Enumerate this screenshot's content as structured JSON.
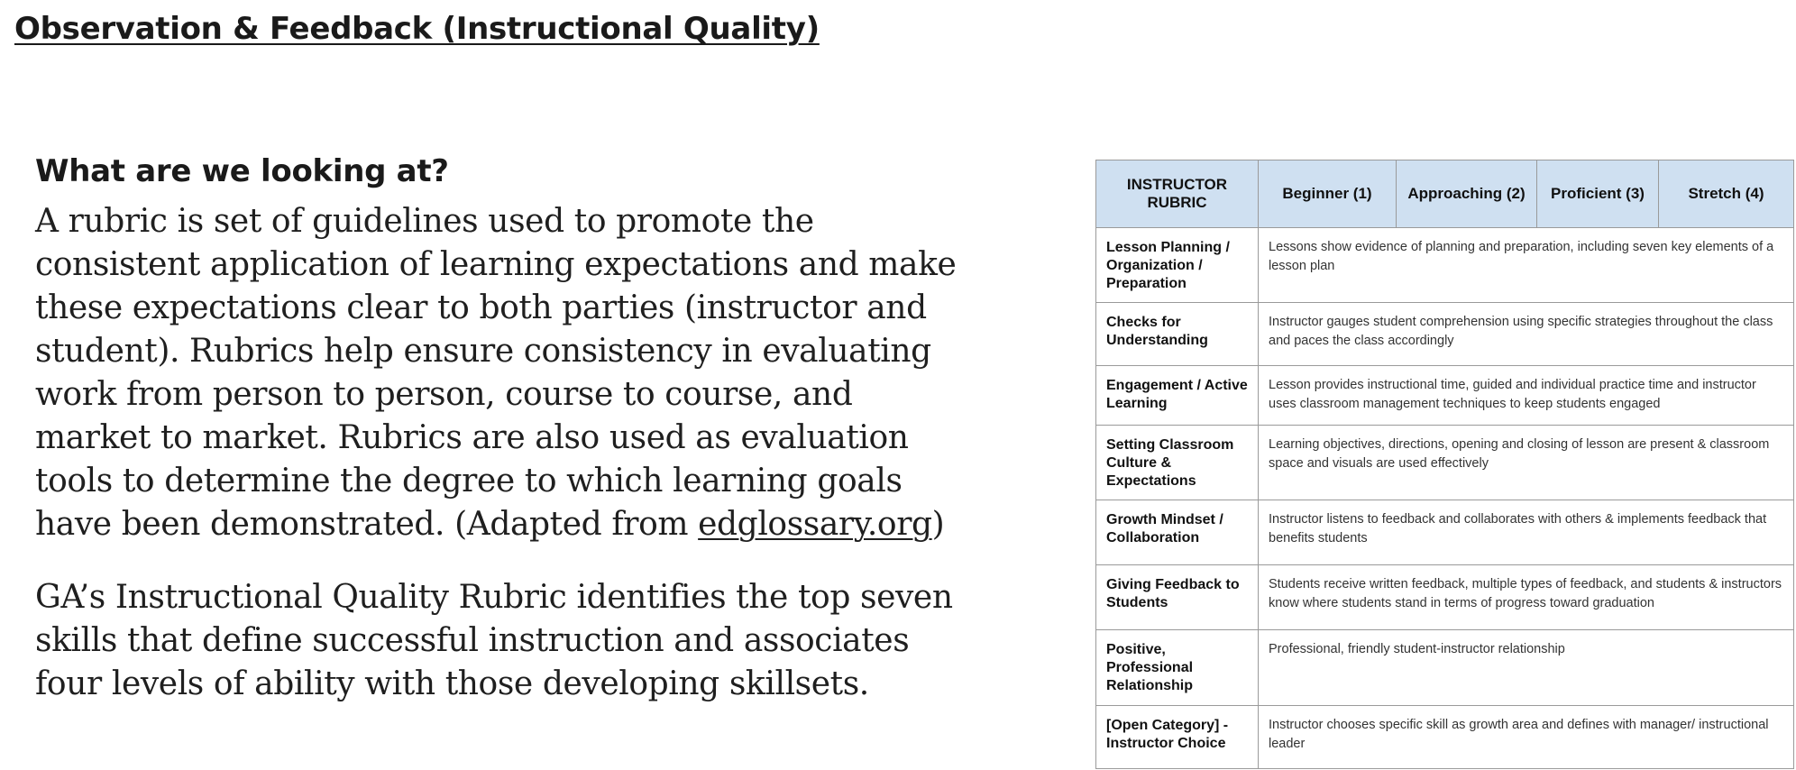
{
  "page": {
    "title": "Observation & Feedback (Instructional Quality)"
  },
  "intro": {
    "heading": "What are we looking at?",
    "paragraph1_text": "A rubric is set of guidelines used to promote the consistent application of learning expectations and make these expectations clear to both parties (instructor and student). Rubrics help ensure consistency in evaluating work from person to person, course to course, and market to market. Rubrics are also used as evaluation tools to determine the degree to which learning goals have been demonstrated. (Adapted from ",
    "paragraph1_link": "edglossary.org",
    "paragraph1_end": ")",
    "paragraph2": "GA’s Instructional Quality Rubric identifies the top seven skills that define successful instruction and associates four levels of ability with those developing skillsets."
  },
  "rubric": {
    "headers": [
      "INSTRUCTOR RUBRIC",
      "Beginner (1)",
      "Approaching (2)",
      "Proficient (3)",
      "Stretch (4)"
    ],
    "rows": [
      {
        "category": "Lesson Planning / Organization / Preparation",
        "description": "Lessons show evidence of planning and preparation, including seven key elements of a lesson plan"
      },
      {
        "category": "Checks for Understanding",
        "description": "Instructor gauges student comprehension using specific strategies throughout the class and paces the class accordingly"
      },
      {
        "category": "Engagement / Active Learning",
        "description": "Lesson provides instructional time, guided and individual practice time and instructor uses classroom management techniques to keep students engaged"
      },
      {
        "category": "Setting Classroom Culture & Expectations",
        "description": "Learning objectives, directions, opening and closing of lesson are present & classroom space and visuals are used effectively"
      },
      {
        "category": "Growth Mindset / Collaboration",
        "description": "Instructor listens to feedback and collaborates with others & implements feedback that benefits students"
      },
      {
        "category": "Giving Feedback to Students",
        "description": "Students receive written feedback, multiple types of feedback, and students & instructors know where students stand in terms of progress toward graduation"
      },
      {
        "category": "Positive, Professional Relationship",
        "description": "Professional, friendly student-instructor relationship"
      },
      {
        "category": "[Open Category] - Instructor Choice",
        "description": "Instructor chooses specific skill as growth area and defines with manager/ instructional leader"
      }
    ]
  },
  "colors": {
    "header_bg": "#cfe0f1",
    "border": "#9a9a9a",
    "text": "#1f1f1f"
  }
}
